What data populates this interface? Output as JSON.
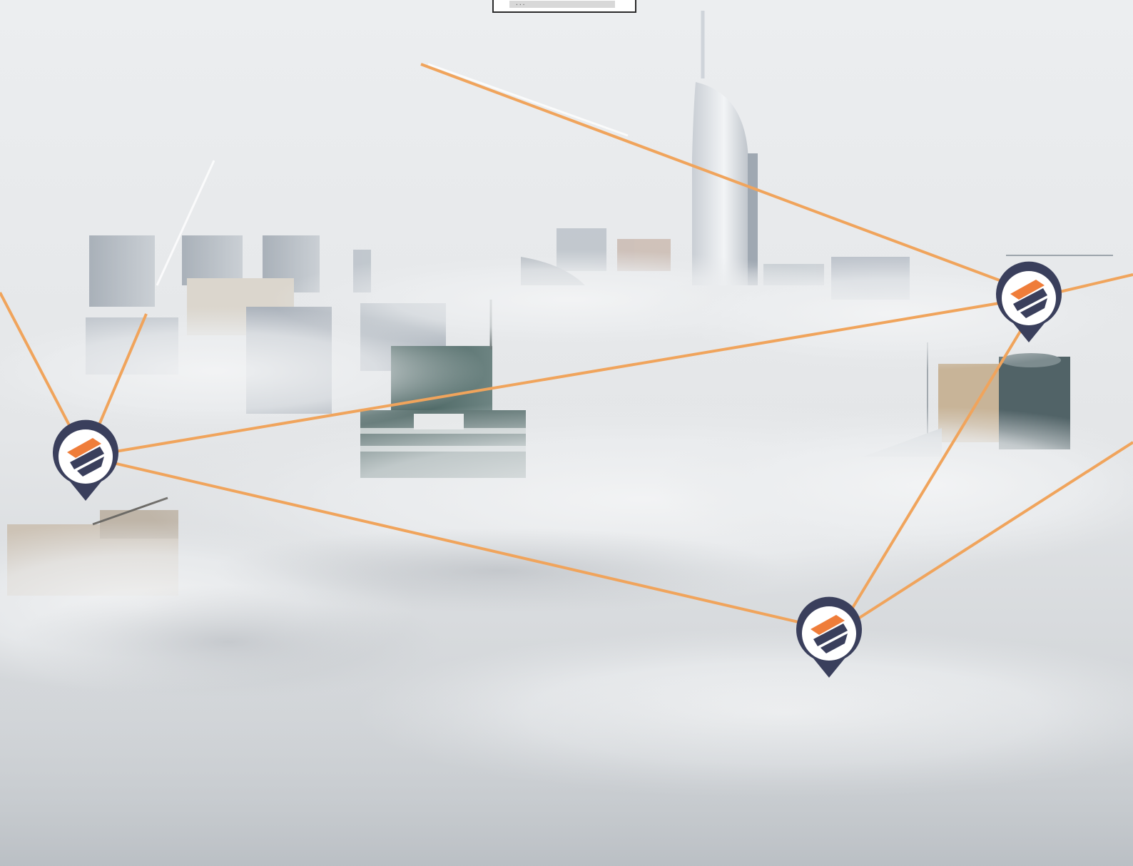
{
  "top_box": {
    "text": "..."
  },
  "colors": {
    "connection_line": "#f0a45c",
    "pin_navy": "#3a3f5c",
    "pin_orange": "#ef7d3a",
    "fog": "#e6e8ea"
  },
  "icons": {
    "marker": "location-pin-icon"
  }
}
